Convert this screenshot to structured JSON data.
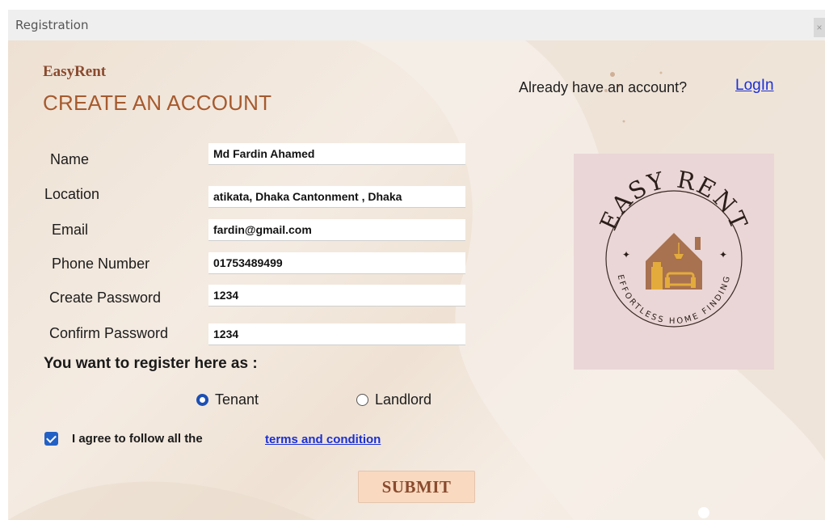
{
  "window": {
    "title": "Registration",
    "close_icon": "×"
  },
  "brand": {
    "name": "EasyRent",
    "heading": "CREATE AN ACCOUNT"
  },
  "account": {
    "prompt": "Already have an account?",
    "login_link": "LogIn"
  },
  "form": {
    "fields": [
      {
        "label": "Name",
        "value": "Md Fardin Ahamed"
      },
      {
        "label": "Location",
        "value": "atikata, Dhaka Cantonment , Dhaka"
      },
      {
        "label": "Email",
        "value": "fardin@gmail.com"
      },
      {
        "label": "Phone Number",
        "value": "01753489499"
      },
      {
        "label": "Create Password",
        "value": "1234"
      },
      {
        "label": "Confirm Password",
        "value": "1234"
      }
    ],
    "register_as_label": "You want to register here as :",
    "roles": [
      {
        "label": "Tenant",
        "selected": true
      },
      {
        "label": "Landlord",
        "selected": false
      }
    ],
    "agree_text": "I agree to follow all the",
    "agree_checked": true,
    "terms_link": "terms and condition",
    "submit_label": "SUBMIT"
  },
  "logo": {
    "top_text": "EASY RENT",
    "bottom_text": "EFFORTLESS HOME FINDING"
  },
  "colors": {
    "brand_brown": "#a65a2e",
    "link_blue": "#1a2fd6",
    "checkbox_blue": "#2360c5",
    "submit_bg": "#f9d9bf",
    "logo_bg": "#ead6d6",
    "house_fill": "#a8714f",
    "furniture_fill": "#e3ab3c"
  }
}
